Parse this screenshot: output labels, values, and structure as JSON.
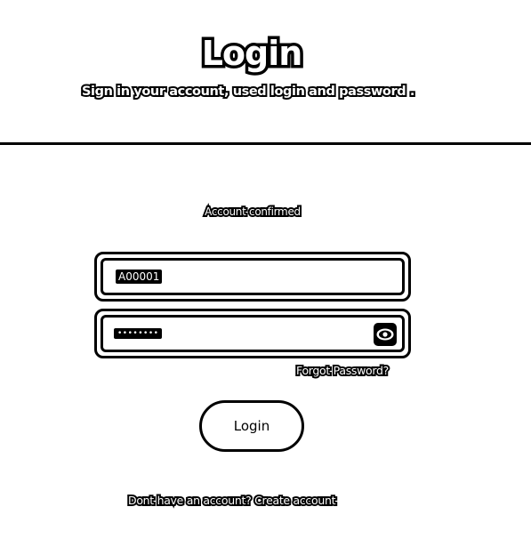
{
  "header": {
    "title": "Login",
    "subtitle": "Sign in your account, used login and password ."
  },
  "status": {
    "message": "Account confirmed"
  },
  "form": {
    "username_value": "A00001",
    "password_mask": "••••••••",
    "eye_icon": "eye-icon",
    "forgot_label": "Forgot Password?",
    "login_label": "Login"
  },
  "footer": {
    "signup_label": "Dont have an account? Create account"
  },
  "colors": {
    "background": "#ffffff",
    "ink": "#000000"
  }
}
